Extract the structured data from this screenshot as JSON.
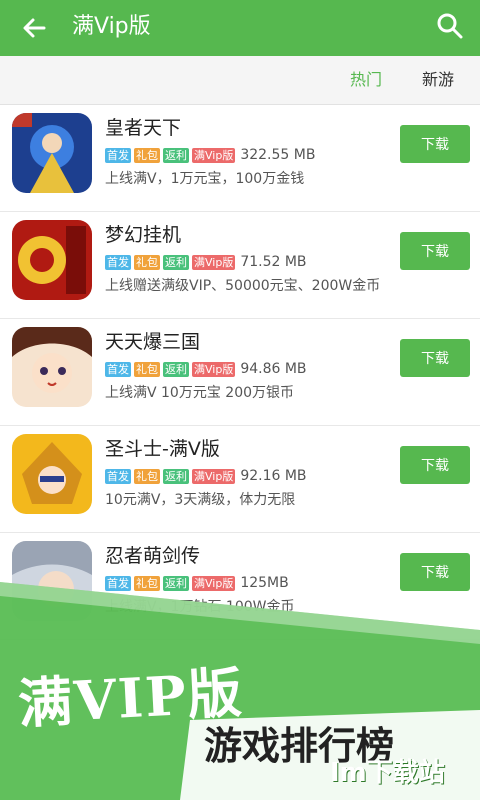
{
  "appbar": {
    "title": "满Vip版",
    "back_icon": "arrow-left-icon",
    "search_icon": "search-icon"
  },
  "tabs": [
    {
      "label": "热门",
      "active": true
    },
    {
      "label": "新游",
      "active": false
    }
  ],
  "tags": {
    "first": "首发",
    "gift": "礼包",
    "rebate": "返利",
    "vip": "满Vip版"
  },
  "games": [
    {
      "name": "皇者天下",
      "size": "322.55 MB",
      "desc": "上线满V，1万元宝，100万金钱",
      "button": "下载"
    },
    {
      "name": "梦幻挂机",
      "size": "71.52 MB",
      "desc": "上线赠送满级VIP、50000元宝、200W金币",
      "button": "下载"
    },
    {
      "name": "天天爆三国",
      "size": "94.86 MB",
      "desc": "上线满V 10万元宝 200万银币",
      "button": "下载"
    },
    {
      "name": "圣斗士-满V版",
      "size": "92.16 MB",
      "desc": "10元满V，3天满级，体力无限",
      "button": "下载"
    },
    {
      "name": "忍者萌剑传",
      "size": "125MB",
      "desc": "上线满V，1万钻石 100W金币",
      "button": "下载"
    }
  ],
  "banner": {
    "headline": "满VIP版",
    "subhead": "游戏排行榜",
    "watermark": "Im下载站"
  },
  "colors": {
    "accent": "#56b84f",
    "tag_first": "#4eb7e8",
    "tag_gift": "#f0a23b",
    "tag_rebate": "#49c17b",
    "tag_vip": "#ec6a6a"
  }
}
